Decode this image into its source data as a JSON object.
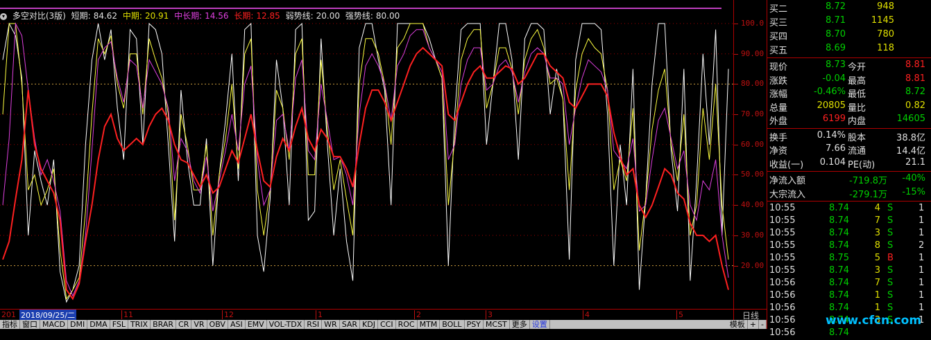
{
  "indicator": {
    "name": "多空对比(3版)",
    "short_label": "短期:",
    "short_value": "84.62",
    "mid_label": "中期:",
    "mid_value": "20.91",
    "midlong_label": "中长期:",
    "midlong_value": "14.56",
    "long_label": "长期:",
    "long_value": "12.85",
    "weak_label": "弱势线:",
    "weak_value": "20.00",
    "strong_label": "强势线:",
    "strong_value": "80.00"
  },
  "colors": {
    "short": "#ffffff",
    "mid": "#ffff40",
    "midlong": "#e040e0",
    "long": "#ff2020",
    "grid": "#a00000",
    "axis": "#c01010"
  },
  "y_axis": {
    "ticks": [
      "100.0",
      "90.00",
      "80.00",
      "70.00",
      "60.00",
      "50.00",
      "40.00",
      "30.00",
      "20.00"
    ]
  },
  "date_bar": {
    "start": "201",
    "selected": "2018/09/25/二",
    "months": [
      "11",
      "12",
      "1",
      "2",
      "3",
      "4",
      "5"
    ]
  },
  "day_button": "日线",
  "tabs": [
    "指标",
    "窗口",
    "MACD",
    "DMI",
    "DMA",
    "FSL",
    "TRIX",
    "BRAR",
    "CR",
    "VR",
    "OBV",
    "ASI",
    "EMV",
    "VOL-TDX",
    "RSI",
    "WR",
    "SAR",
    "KDJ",
    "CCI",
    "ROC",
    "MTM",
    "BOLL",
    "PSY",
    "MCST",
    "更多",
    "设置"
  ],
  "right_tabs": [
    "模板",
    "+",
    "-"
  ],
  "quotes": {
    "bids": [
      {
        "label": "买二",
        "price": "8.72",
        "vol": "948"
      },
      {
        "label": "买三",
        "price": "8.71",
        "vol": "1145"
      },
      {
        "label": "买四",
        "price": "8.70",
        "vol": "780"
      },
      {
        "label": "买五",
        "price": "8.69",
        "vol": "118"
      }
    ],
    "stats": [
      {
        "l1": "现价",
        "v1": "8.73",
        "c1": "green",
        "l2": "今开",
        "v2": "8.81",
        "c2": "red"
      },
      {
        "l1": "涨跌",
        "v1": "-0.04",
        "c1": "green",
        "l2": "最高",
        "v2": "8.81",
        "c2": "red"
      },
      {
        "l1": "涨幅",
        "v1": "-0.46%",
        "c1": "green",
        "l2": "最低",
        "v2": "8.72",
        "c2": "green"
      },
      {
        "l1": "总量",
        "v1": "20805",
        "c1": "yellow",
        "l2": "量比",
        "v2": "0.82",
        "c2": "yellow"
      },
      {
        "l1": "外盘",
        "v1": "6199",
        "c1": "red",
        "l2": "内盘",
        "v2": "14605",
        "c2": "green"
      }
    ],
    "fundamentals": [
      {
        "l1": "换手",
        "v1": "0.14%",
        "l2": "股本",
        "v2": "38.8亿"
      },
      {
        "l1": "净资",
        "v1": "7.66",
        "l2": "流通",
        "v2": "14.4亿"
      },
      {
        "l1": "收益(一)",
        "v1": "0.104",
        "l2": "PE(动)",
        "v2": "21.1"
      }
    ],
    "flows": [
      {
        "label": "净流入额",
        "value": "-719.8万",
        "pct": "-40%"
      },
      {
        "label": "大宗流入",
        "value": "-279.1万",
        "pct": "-15%"
      }
    ],
    "ticks": [
      {
        "time": "10:55",
        "price": "8.74",
        "vol": "4",
        "side": "S",
        "extra": "1"
      },
      {
        "time": "10:55",
        "price": "8.74",
        "vol": "7",
        "side": "S",
        "extra": "1"
      },
      {
        "time": "10:55",
        "price": "8.74",
        "vol": "3",
        "side": "S",
        "extra": "1"
      },
      {
        "time": "10:55",
        "price": "8.74",
        "vol": "8",
        "side": "S",
        "extra": "2"
      },
      {
        "time": "10:55",
        "price": "8.75",
        "vol": "5",
        "side": "B",
        "extra": "1"
      },
      {
        "time": "10:55",
        "price": "8.74",
        "vol": "3",
        "side": "S",
        "extra": "1"
      },
      {
        "time": "10:56",
        "price": "8.74",
        "vol": "7",
        "side": "S",
        "extra": "1"
      },
      {
        "time": "10:56",
        "price": "8.74",
        "vol": "1",
        "side": "S",
        "extra": "1"
      },
      {
        "time": "10:56",
        "price": "8.74",
        "vol": "1",
        "side": "S",
        "extra": "1"
      },
      {
        "time": "10:56",
        "price": "8.74",
        "vol": "3",
        "side": "S",
        "extra": "1"
      },
      {
        "time": "10:56",
        "price": "8.74",
        "vol": "",
        "side": "",
        "extra": ""
      }
    ]
  },
  "watermark": "www.cfcn.com",
  "chart_data": {
    "type": "line",
    "ylim": [
      8,
      100
    ],
    "reference_lines": [
      20,
      80
    ],
    "series": [
      {
        "name": "短期",
        "values": [
          88,
          100,
          96,
          82,
          30,
          58,
          48,
          40,
          55,
          18,
          8,
          12,
          20,
          60,
          88,
          100,
          88,
          98,
          72,
          55,
          98,
          95,
          60,
          100,
          98,
          90,
          60,
          28,
          78,
          55,
          40,
          40,
          62,
          20,
          50,
          68,
          90,
          48,
          98,
          100,
          30,
          18,
          42,
          88,
          72,
          40,
          98,
          100,
          35,
          38,
          95,
          60,
          30,
          52,
          28,
          15,
          92,
          100,
          100,
          88,
          78,
          40,
          100,
          100,
          100,
          100,
          100,
          95,
          88,
          82,
          20,
          70,
          98,
          100,
          100,
          100,
          60,
          80,
          100,
          100,
          88,
          55,
          95,
          100,
          100,
          98,
          70,
          85,
          75,
          22,
          88,
          100,
          100,
          100,
          98,
          70,
          20,
          60,
          40,
          85,
          12,
          42,
          80,
          100,
          100,
          58,
          38,
          85,
          15,
          48,
          90,
          60,
          98,
          30,
          85
        ]
      },
      {
        "name": "中期",
        "values": [
          70,
          100,
          100,
          80,
          45,
          50,
          40,
          45,
          52,
          25,
          9,
          12,
          16,
          38,
          70,
          95,
          90,
          96,
          80,
          72,
          90,
          90,
          70,
          95,
          88,
          82,
          70,
          35,
          70,
          60,
          45,
          45,
          60,
          30,
          50,
          62,
          80,
          52,
          90,
          95,
          45,
          30,
          45,
          78,
          72,
          55,
          90,
          95,
          50,
          50,
          88,
          65,
          45,
          55,
          42,
          30,
          80,
          95,
          95,
          90,
          80,
          60,
          92,
          95,
          100,
          100,
          100,
          92,
          88,
          82,
          40,
          62,
          88,
          95,
          98,
          98,
          72,
          80,
          92,
          92,
          85,
          70,
          88,
          95,
          98,
          92,
          80,
          82,
          75,
          45,
          78,
          90,
          95,
          92,
          90,
          78,
          45,
          55,
          48,
          72,
          25,
          42,
          65,
          78,
          85,
          60,
          48,
          70,
          30,
          40,
          72,
          55,
          80,
          40,
          22
        ]
      },
      {
        "name": "中长期",
        "values": [
          40,
          62,
          100,
          96,
          78,
          62,
          50,
          55,
          48,
          38,
          15,
          10,
          15,
          30,
          58,
          88,
          92,
          94,
          82,
          74,
          88,
          86,
          72,
          88,
          84,
          80,
          72,
          48,
          62,
          58,
          48,
          44,
          56,
          38,
          48,
          58,
          70,
          58,
          80,
          86,
          55,
          40,
          45,
          68,
          70,
          58,
          82,
          88,
          58,
          55,
          80,
          68,
          55,
          56,
          50,
          40,
          70,
          86,
          90,
          86,
          80,
          68,
          86,
          90,
          96,
          98,
          98,
          92,
          88,
          84,
          55,
          60,
          80,
          88,
          92,
          92,
          78,
          80,
          86,
          88,
          84,
          74,
          84,
          90,
          92,
          90,
          82,
          82,
          80,
          60,
          72,
          82,
          88,
          86,
          84,
          78,
          58,
          55,
          52,
          62,
          38,
          40,
          55,
          68,
          72,
          62,
          52,
          58,
          40,
          35,
          48,
          45,
          55,
          30,
          16
        ]
      },
      {
        "name": "长期",
        "values": [
          22,
          28,
          42,
          55,
          78,
          60,
          52,
          48,
          44,
          35,
          12,
          9,
          14,
          28,
          40,
          55,
          66,
          70,
          62,
          58,
          60,
          62,
          60,
          66,
          70,
          72,
          68,
          60,
          55,
          54,
          50,
          46,
          50,
          44,
          46,
          52,
          58,
          54,
          62,
          70,
          58,
          48,
          46,
          56,
          62,
          58,
          66,
          72,
          62,
          58,
          65,
          62,
          56,
          56,
          52,
          46,
          60,
          72,
          78,
          78,
          74,
          68,
          74,
          80,
          86,
          90,
          92,
          90,
          88,
          86,
          70,
          68,
          74,
          80,
          84,
          86,
          82,
          82,
          84,
          86,
          85,
          80,
          82,
          86,
          90,
          90,
          86,
          84,
          82,
          74,
          72,
          76,
          80,
          80,
          80,
          76,
          64,
          56,
          50,
          52,
          40,
          36,
          40,
          46,
          52,
          50,
          44,
          42,
          34,
          30,
          30,
          28,
          30,
          20,
          12
        ]
      }
    ]
  }
}
